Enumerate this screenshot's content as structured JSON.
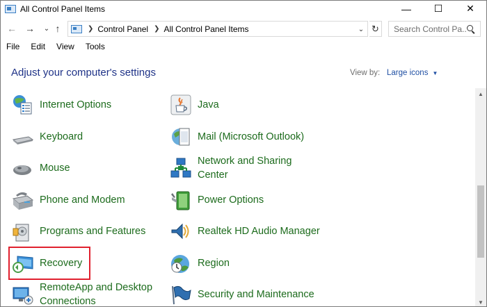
{
  "window": {
    "title": "All Control Panel Items",
    "minimize": "—",
    "maximize": "☐",
    "close": "✕"
  },
  "nav": {
    "back": "←",
    "forward": "→",
    "recent": "⌄",
    "up": "↑",
    "refresh": "↻",
    "dropdown": "⌄"
  },
  "address": {
    "crumbs": [
      "Control Panel",
      "All Control Panel Items"
    ]
  },
  "search": {
    "placeholder": "Search Control Pa..."
  },
  "menu": [
    "File",
    "Edit",
    "View",
    "Tools"
  ],
  "content": {
    "heading": "Adjust your computer's settings",
    "view_by_label": "View by:",
    "view_by_value": "Large icons"
  },
  "items": {
    "left": [
      {
        "label": "Internet Options",
        "icon": "internet-options-icon"
      },
      {
        "label": "Keyboard",
        "icon": "keyboard-icon"
      },
      {
        "label": "Mouse",
        "icon": "mouse-icon"
      },
      {
        "label": "Phone and Modem",
        "icon": "phone-modem-icon"
      },
      {
        "label": "Programs and Features",
        "icon": "programs-features-icon"
      },
      {
        "label": "Recovery",
        "icon": "recovery-icon"
      },
      {
        "label_line1": "RemoteApp and Desktop",
        "label_line2": "Connections",
        "icon": "remoteapp-icon"
      }
    ],
    "right": [
      {
        "label": "Java",
        "icon": "java-icon"
      },
      {
        "label": "Mail (Microsoft Outlook)",
        "icon": "mail-icon"
      },
      {
        "label_line1": "Network and Sharing",
        "label_line2": "Center",
        "icon": "network-icon"
      },
      {
        "label": "Power Options",
        "icon": "power-options-icon"
      },
      {
        "label": "Realtek HD Audio Manager",
        "icon": "realtek-audio-icon"
      },
      {
        "label": "Region",
        "icon": "region-icon"
      },
      {
        "label": "Security and Maintenance",
        "icon": "security-flag-icon"
      }
    ]
  },
  "colors": {
    "link_green": "#1c6b1c",
    "heading_blue": "#1e3287",
    "highlight_red": "#e0202e"
  }
}
